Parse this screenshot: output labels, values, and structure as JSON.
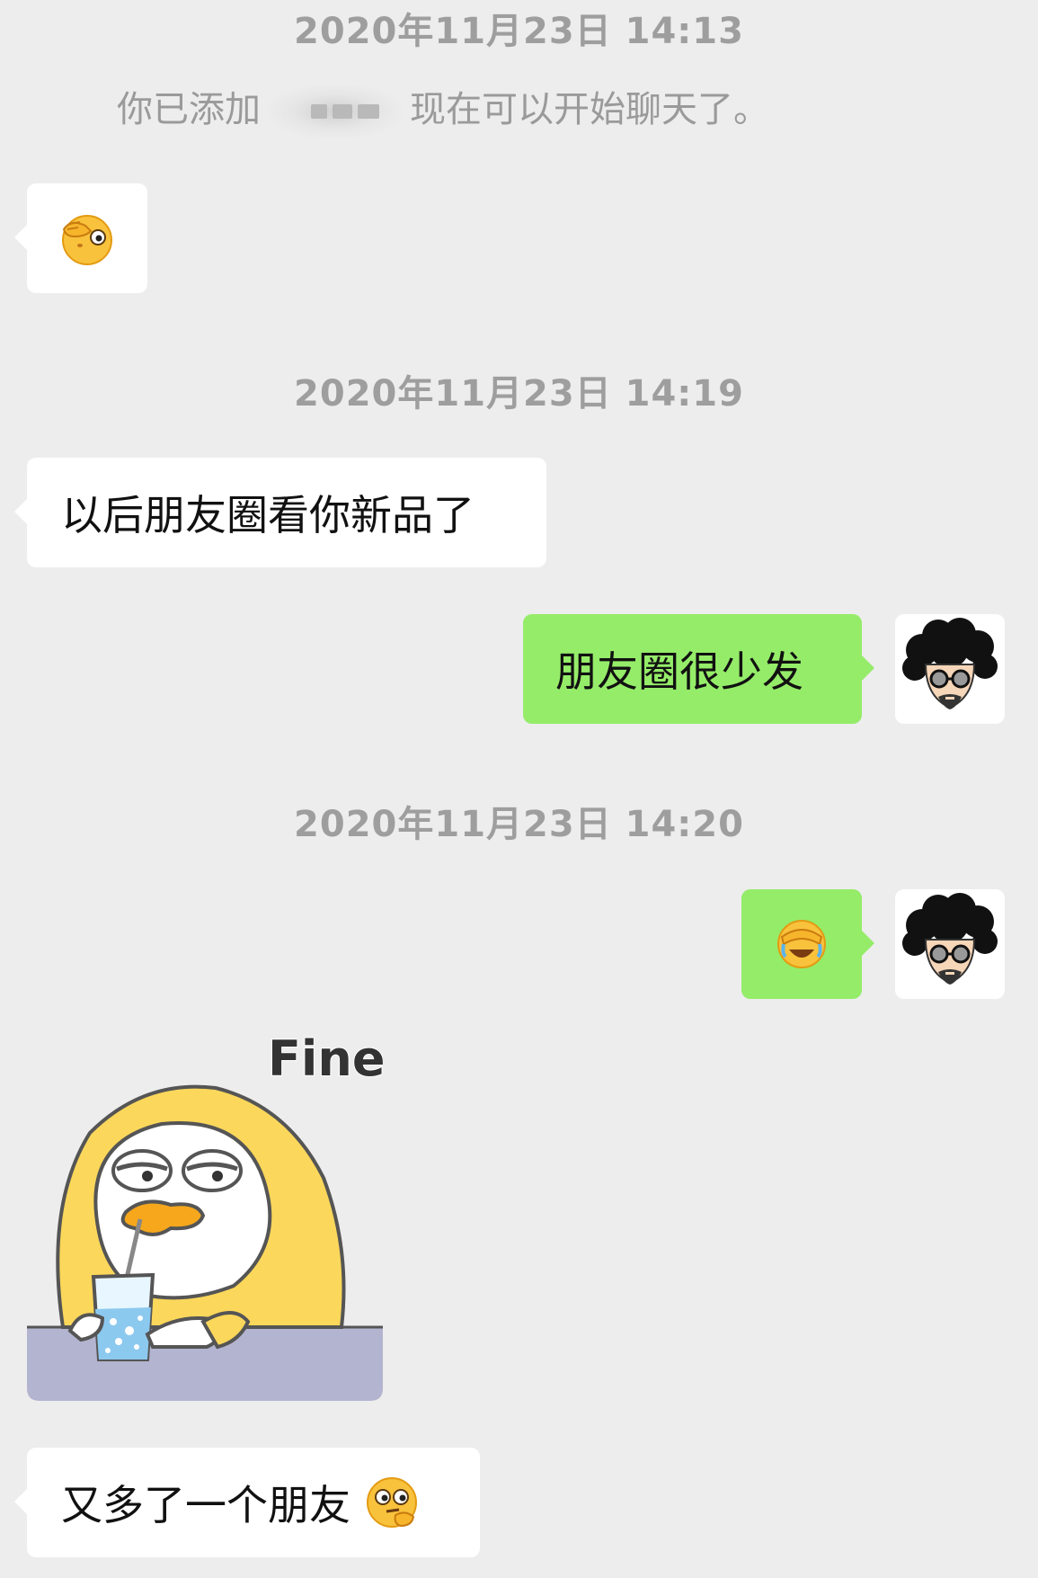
{
  "timestamps": [
    "2020年11月23日 14:13",
    "2020年11月23日 14:19",
    "2020年11月23日 14:20"
  ],
  "system_note": {
    "prefix": "你已添加",
    "suffix": "现在可以开始聊天了。"
  },
  "messages": [
    {
      "side": "left",
      "type": "emoji",
      "icon": "hand-over-eye-emoji"
    },
    {
      "side": "left",
      "type": "text",
      "text": "以后朋友圈看你新品了"
    },
    {
      "side": "right",
      "type": "text",
      "text": "朋友圈很少发"
    },
    {
      "side": "right",
      "type": "emoji",
      "icon": "facepalm-laugh-emoji"
    },
    {
      "side": "left",
      "type": "sticker",
      "caption": "Fine",
      "icon": "yellow-duck-sticker"
    },
    {
      "side": "left",
      "type": "text",
      "text": "又多了一个朋友",
      "trailing_icon": "thinking-emoji"
    }
  ],
  "colors": {
    "background": "#ededed",
    "incoming_bubble": "#ffffff",
    "outgoing_bubble": "#95ec69",
    "timestamp_text": "#9e9e9e"
  }
}
